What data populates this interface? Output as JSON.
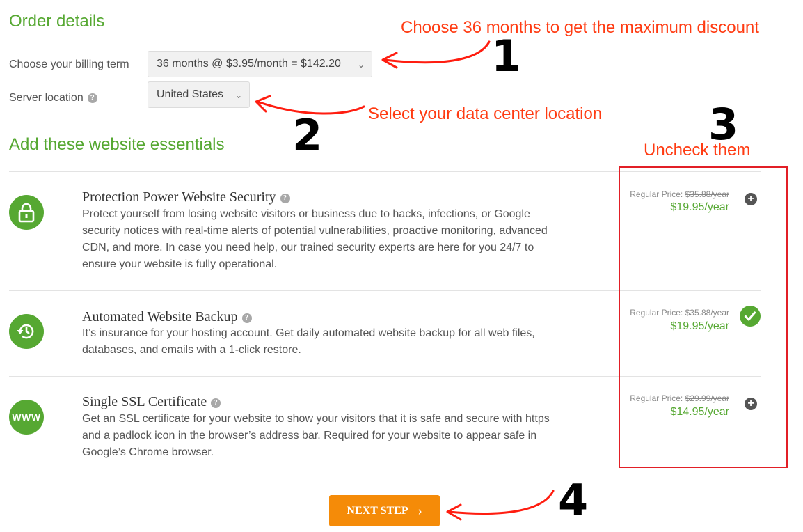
{
  "order": {
    "title": "Order details",
    "billing_label": "Choose your billing term",
    "billing_value": "36 months @ $3.95/month = $142.20",
    "location_label": "Server location",
    "location_value": "United States"
  },
  "essentials": {
    "title": "Add these website essentials",
    "items": [
      {
        "title": "Protection Power Website Security",
        "description": "Protect yourself from losing website visitors or business due to hacks, infections, or Google security notices with real-time alerts of potential vulnerabilities, proactive monitoring, advanced CDN, and more. In case you need help, our trained security experts are here for you 24/7 to ensure your website is fully operational.",
        "regular_label": "Regular Price:",
        "regular_price": "$35.88/year",
        "price": "$19.95/year",
        "toggle": "+",
        "selected": false,
        "icon": "lock-icon"
      },
      {
        "title": "Automated Website Backup",
        "description": "It’s insurance for your hosting account. Get daily automated website backup for all web files, databases, and emails with a 1-click restore.",
        "regular_label": "Regular Price:",
        "regular_price": "$35.88/year",
        "price": "$19.95/year",
        "selected": true,
        "icon": "backup-history-icon"
      },
      {
        "title": "Single SSL Certificate",
        "description": "Get an SSL certificate for your website to show your visitors that it is safe and secure with https and a padlock icon in the browser’s address bar. Required for your website to appear safe in Google’s Chrome browser.",
        "regular_label": "Regular Price:",
        "regular_price": "$29.99/year",
        "price": "$14.95/year",
        "toggle": "+",
        "selected": false,
        "icon": "www-icon",
        "icon_text": "WWW"
      }
    ]
  },
  "next_button": {
    "label": "NEXT STEP",
    "chevron": "›"
  },
  "annotations": {
    "note1": "Choose 36 months to get the maximum discount",
    "note2": "Select your data center location",
    "note3": "Uncheck them",
    "num1": "1",
    "num2": "2",
    "num3": "3",
    "num4": "4"
  },
  "colors": {
    "brand_green": "#56a832",
    "annotation_red": "#ff3b12",
    "button_orange": "#f58b08"
  }
}
